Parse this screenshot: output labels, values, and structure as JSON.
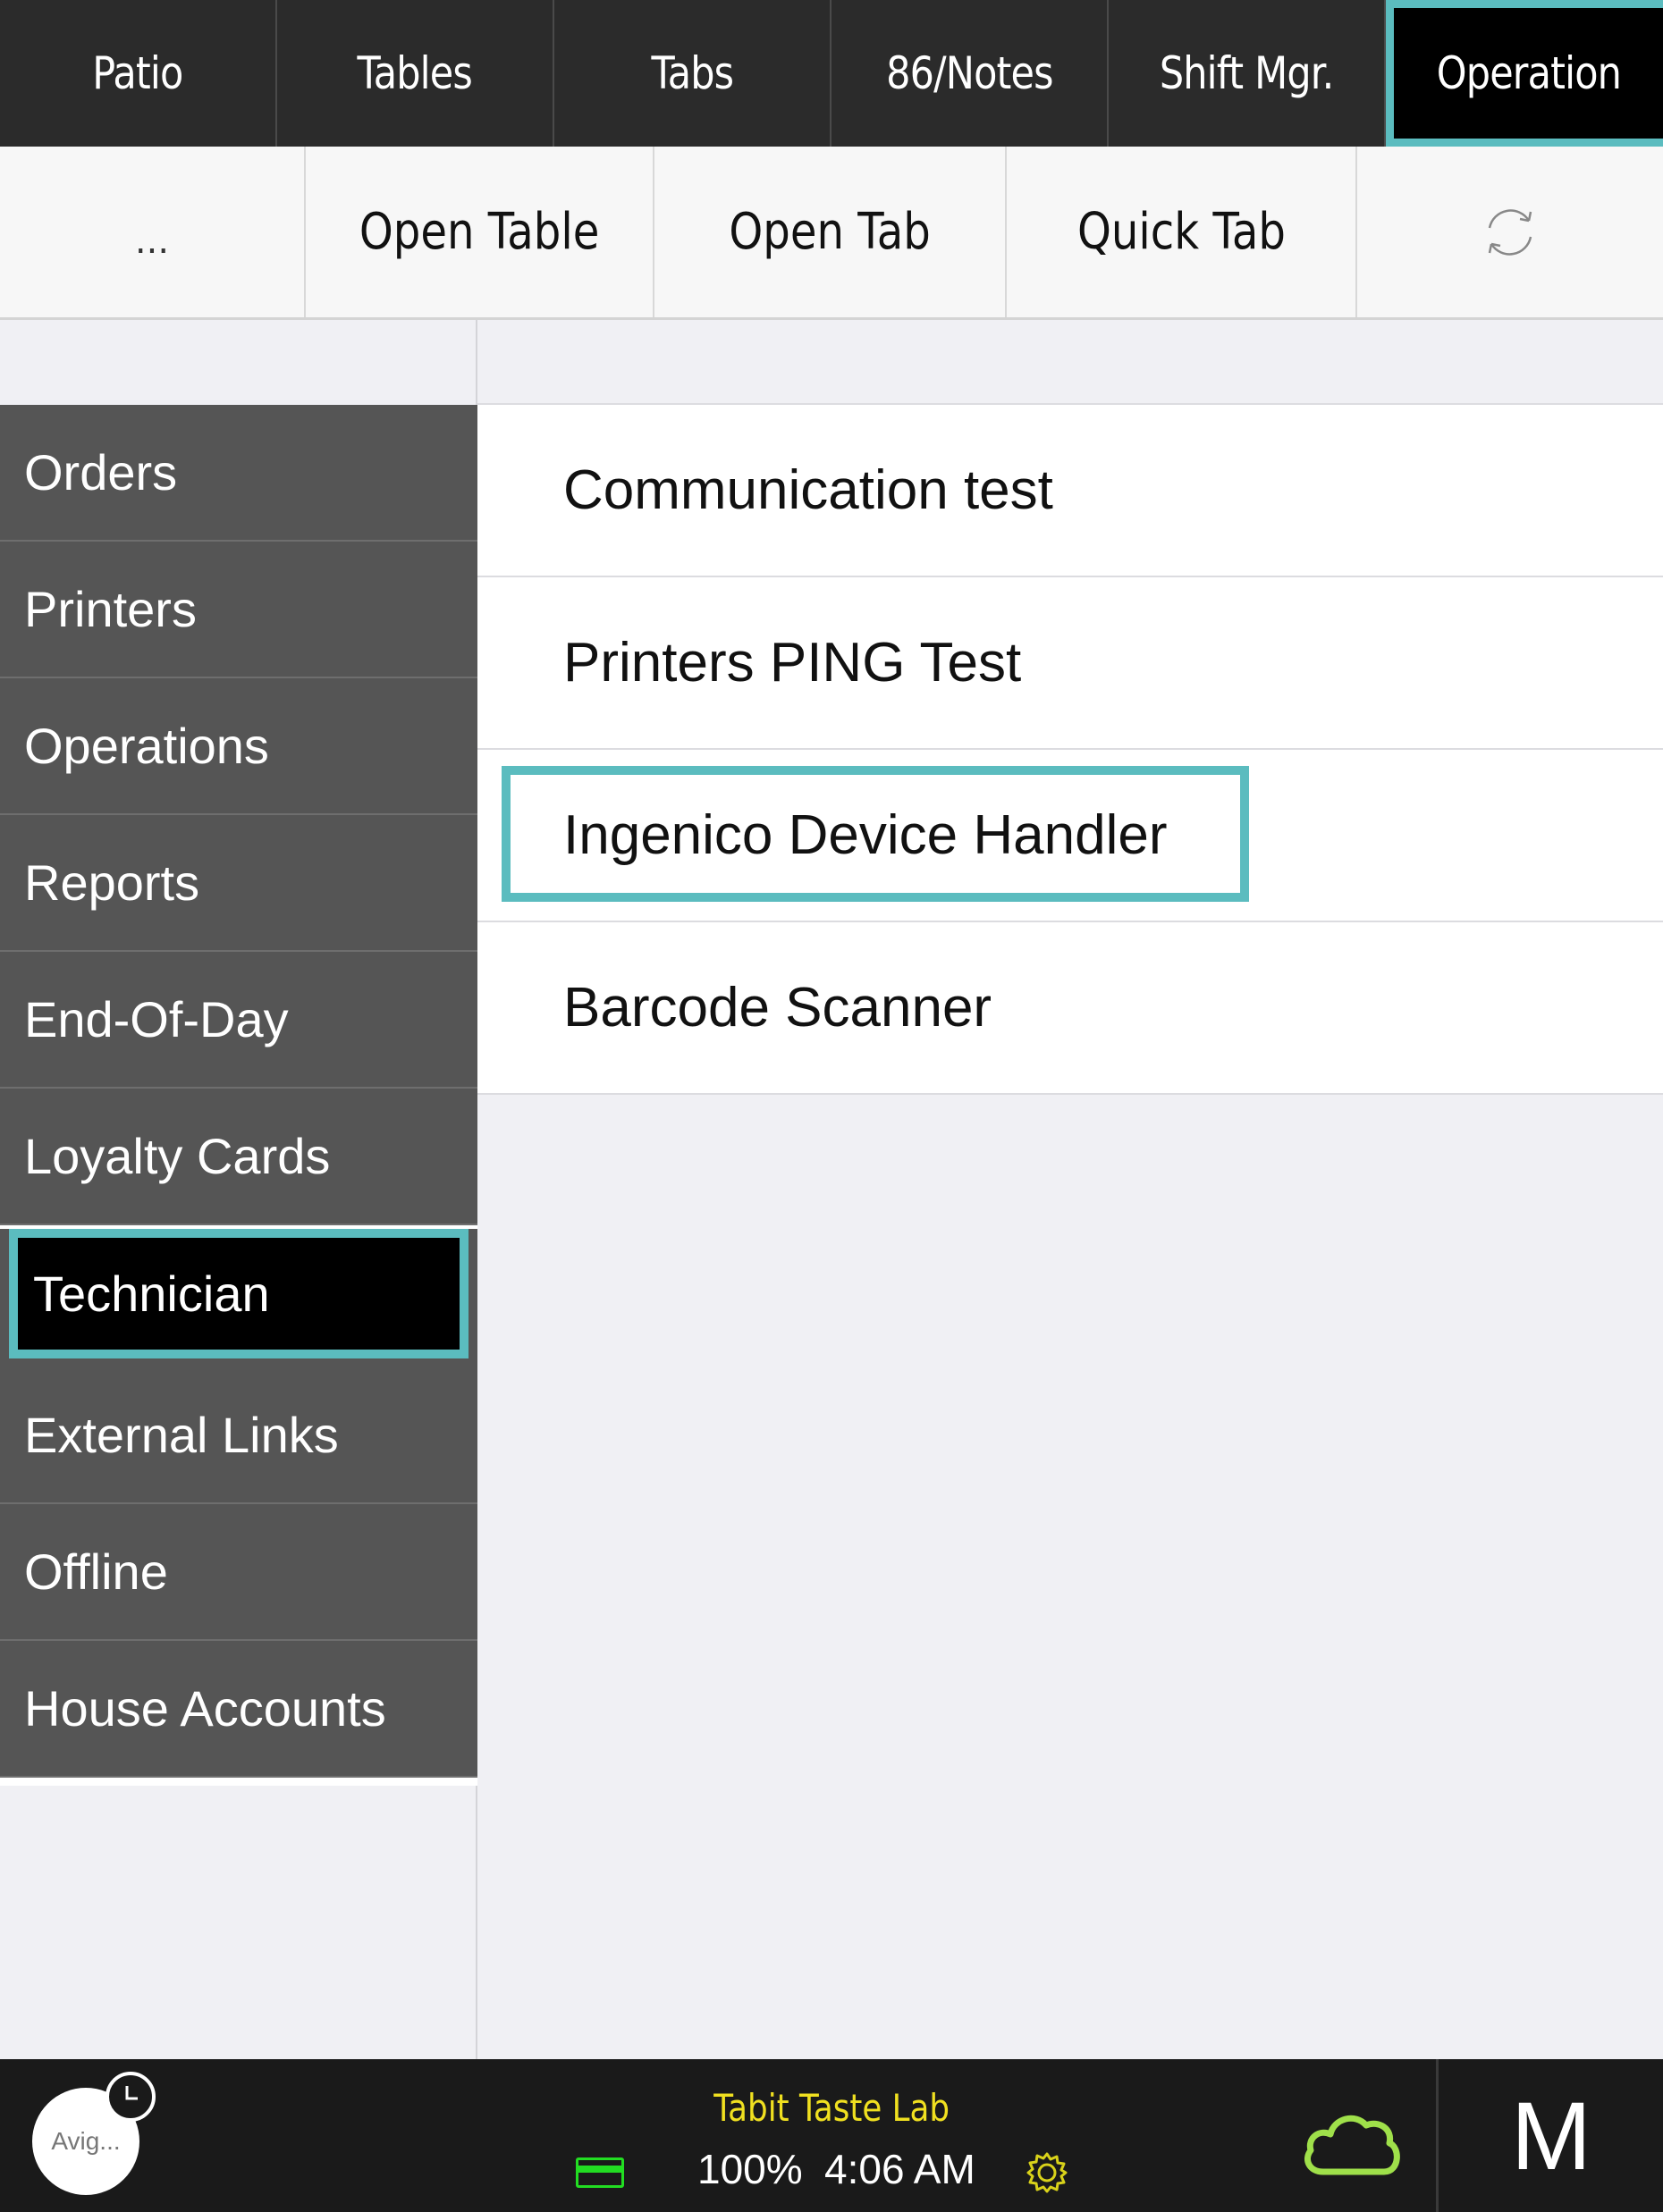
{
  "top_tabs": [
    {
      "label": "Patio"
    },
    {
      "label": "Tables"
    },
    {
      "label": "Tabs"
    },
    {
      "label": "86/Notes"
    },
    {
      "label": "Shift Mgr."
    },
    {
      "label": "Operation",
      "active": true
    }
  ],
  "action_bar": {
    "more_label": "...",
    "open_table": "Open Table",
    "open_tab": "Open Tab",
    "quick_tab": "Quick Tab",
    "refresh_icon": "refresh-icon"
  },
  "sidebar": {
    "items": [
      {
        "label": "Orders"
      },
      {
        "label": "Printers"
      },
      {
        "label": "Operations"
      },
      {
        "label": "Reports"
      },
      {
        "label": "End-Of-Day"
      },
      {
        "label": "Loyalty Cards"
      },
      {
        "label": "Technician",
        "active": true
      },
      {
        "label": "External Links"
      },
      {
        "label": "Offline"
      },
      {
        "label": "House Accounts"
      }
    ]
  },
  "technician_list": {
    "items": [
      {
        "label": "Communication test"
      },
      {
        "label": "Printers PING Test"
      },
      {
        "label": "Ingenico Device Handler",
        "highlighted": true
      },
      {
        "label": "Barcode Scanner"
      }
    ]
  },
  "status_bar": {
    "user_short": "Avig...",
    "restaurant": "Tabit Taste Lab",
    "battery": "100%",
    "time": "4:06 AM",
    "user_initial": "M",
    "colors": {
      "restaurant_text": "#f0e020",
      "card_icon": "#22dd22",
      "settings_icon": "#d9d21a",
      "cloud_icon": "#9fe04a"
    }
  },
  "colors": {
    "accent_highlight": "#5bbcbf",
    "top_bar": "#2b2b2b",
    "sidebar": "#555555"
  }
}
